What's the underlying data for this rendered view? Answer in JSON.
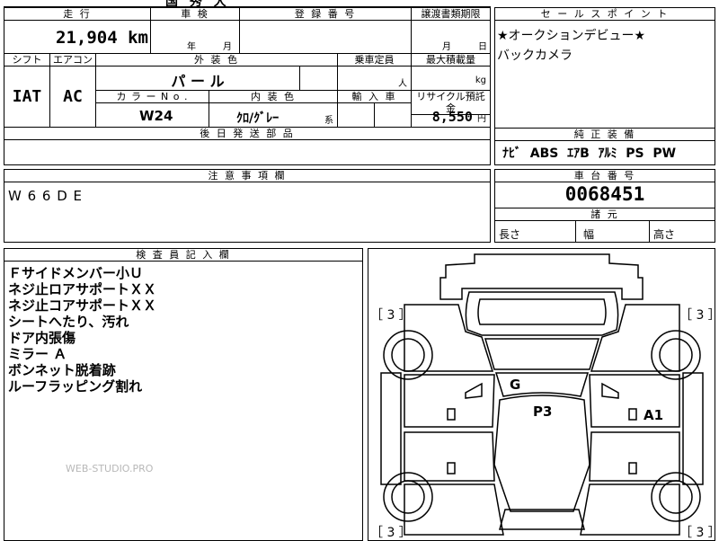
{
  "top_left_fragment": "国 秀 大",
  "vehicle": {
    "mileage_label": "走 行",
    "mileage_value": "21,904",
    "mileage_unit": "km",
    "inspection_label": "車 検",
    "inspection_year": "年",
    "inspection_month": "月",
    "registration_label": "登 録 番 号",
    "transfer_label": "譲渡書類期限",
    "transfer_month": "月",
    "transfer_day": "日",
    "shift_label": "シフト",
    "shift_value": "IAT",
    "ac_label": "エアコン",
    "ac_value": "AC",
    "exterior_label": "外 装 色",
    "exterior_value": "パ ー ル",
    "capacity_label": "乗車定員",
    "capacity_unit": "人",
    "maxload_label": "最大積載量",
    "maxload_unit": "kg",
    "color_no_label": "カ ラ ー N o .",
    "color_no_value": "W24",
    "interior_label": "内 装 色",
    "interior_value": "ｸﾛ/ｸﾞﾚｰ",
    "interior_suffix": "系",
    "import_label": "輸 入 車",
    "recycle_label": "リサイクル預託金",
    "recycle_value": "8,550",
    "recycle_unit": "円",
    "shipping_label": "後 日 発 送 部 品"
  },
  "sales": {
    "label": "セ ー ル ス ポ イ ン ト",
    "line1": "★オークションデビュー★",
    "line2": "バックカメラ"
  },
  "standard_equipment": {
    "label": "純 正 装 備",
    "value": "ﾅﾋﾞ  ABS  ｴｱB  ｱﾙﾐ  PS  PW"
  },
  "notes": {
    "label": "注 意 事 項 欄",
    "value": "W 6 6 D E"
  },
  "chassis": {
    "label": "車 台 番 号",
    "value": "0068451",
    "specs_label": "諸 元",
    "length_label": "長さ",
    "width_label": "幅",
    "height_label": "高さ"
  },
  "inspector": {
    "label": "検 査 員 記 入 欄",
    "lines": [
      "Ｆサイドメンバー小Ｕ",
      "ネジ止ロアサポートＸＸ",
      "ネジ止コアサポートＸＸ",
      "シートへたり、汚れ",
      "ドア内張傷",
      "ミラー Ａ",
      "ボンネット脱着跡",
      "ルーフラッピング割れ"
    ],
    "watermark": "WEB-STUDIO.PRO"
  },
  "diagram": {
    "tire_tl": "［ 3 ］",
    "tire_tr": "［ 3 ］",
    "tire_bl": "［ 3 ］",
    "tire_br": "［ 3 ］",
    "mark_g": "G",
    "mark_p3": "P3",
    "mark_a1": "A1"
  }
}
